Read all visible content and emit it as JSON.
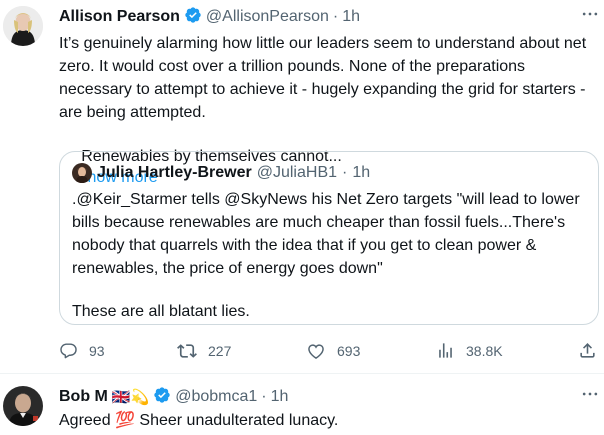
{
  "tweet": {
    "author_name": "Allison Pearson",
    "handle": "@AllisonPearson",
    "separator": "·",
    "time": "1h",
    "lines": [
      "It’s genuinely alarming how little our leaders seem to understand about net",
      "zero. It would cost over a trillion pounds. None of the preparations",
      "necessary to attempt to achieve it - hugely expanding the grid for starters -",
      "are being attempted."
    ],
    "last_line": " Renewables by themselves cannot...",
    "show_more": "Show more",
    "icons": {
      "verified": "verified-badge-icon",
      "more": "more-icon"
    }
  },
  "quote": {
    "author_name": "Julia Hartley-Brewer",
    "handle": "@JuliaHB1",
    "separator": "·",
    "time": "1h",
    "lines": [
      ".@Keir_Starmer tells @SkyNews his Net Zero targets \"will lead to lower",
      "bills because renewables are much cheaper than fossil fuels...There's",
      "nobody that quarrels with the idea that if you get to clean power &",
      "renewables, the price of energy goes down\""
    ],
    "final_line": "These are all blatant lies."
  },
  "actions": {
    "replies": "93",
    "retweets": "227",
    "likes": "693",
    "views": "38.8K",
    "icons": [
      "reply-icon",
      "retweet-icon",
      "like-icon",
      "views-icon",
      "share-icon"
    ]
  },
  "reply": {
    "author_name": "Bob M",
    "emojis": "🇬🇧💫",
    "handle": "@bobmca1",
    "separator": "·",
    "time": "1h",
    "text_before": "Agreed ",
    "emoji_100": "💯",
    "text_after": " Sheer unadulterated lunacy."
  },
  "colors": {
    "accent": "#1d9bf0",
    "muted": "#536471",
    "text": "#0f1419",
    "border": "#cfd9de"
  }
}
